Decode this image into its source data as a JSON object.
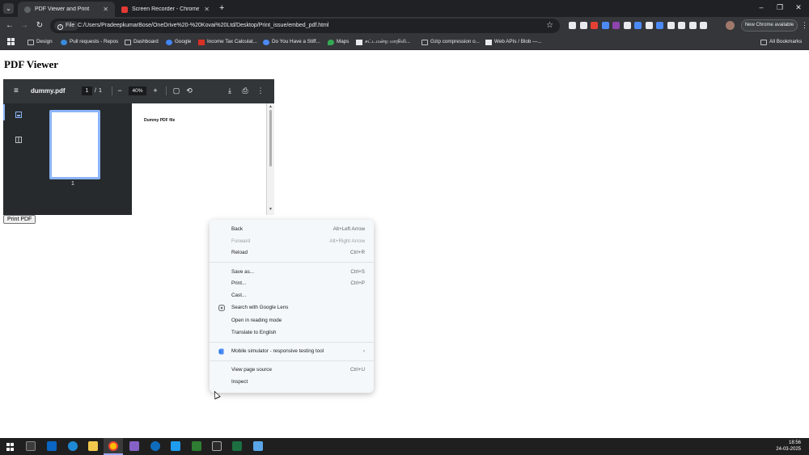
{
  "browser": {
    "tabs": [
      {
        "title": "PDF Viewer and Print",
        "close": "✕"
      },
      {
        "title": "Screen Recorder - Chrome Web",
        "close": "✕"
      }
    ],
    "tab_search_icon": "⌄",
    "new_tab": "+",
    "window_controls": {
      "minimize": "–",
      "restore": "❐",
      "close": "✕"
    },
    "nav": {
      "back": "←",
      "forward": "→",
      "reload": "↻"
    },
    "omnibox": {
      "chip": "File",
      "url": "C:/Users/PradeepkumarBose/OneDrive%20-%20Kovai%20Ltd/Desktop/Print_issue/embed_pdf.html",
      "bookmark_star": "☆"
    },
    "new_chrome_label": "New Chrome available",
    "menu_icon": "⋮",
    "extension_colors": [
      "#e8eaed",
      "#e8eaed",
      "#e44134",
      "#4c8bf5",
      "#8e44ad",
      "#e8eaed",
      "#4c8bf5",
      "#e8eaed",
      "#4c8bf5",
      "#e8eaed",
      "#e8eaed",
      "#e8eaed",
      "#e8eaed"
    ]
  },
  "bookmarks": {
    "items": [
      {
        "label": "Design",
        "icon": "folder-icon"
      },
      {
        "label": "Pull requests - Repos",
        "icon": "azure-devops-icon"
      },
      {
        "label": "Dashboard",
        "icon": "folder-icon"
      },
      {
        "label": "Google",
        "icon": "google-icon"
      },
      {
        "label": "Income Tax Calculat...",
        "icon": "calculator-icon"
      },
      {
        "label": "Do You Have a Stiff...",
        "icon": "site-icon"
      },
      {
        "label": "Maps",
        "icon": "maps-icon"
      },
      {
        "label": "சட்டமன்ற மாநிலி...",
        "icon": "site-icon"
      },
      {
        "label": "Gzip compression o...",
        "icon": "folder-icon"
      },
      {
        "label": "Web APIs / Blob —...",
        "icon": "mdn-icon"
      }
    ],
    "all_bookmarks": "All Bookmarks"
  },
  "page": {
    "title": "PDF Viewer",
    "print_button": "Print PDF"
  },
  "pdf_viewer": {
    "menu_icon": "≡",
    "filename": "dummy.pdf",
    "current_page": "1",
    "page_separator": "/",
    "total_pages": "1",
    "zoom_out": "−",
    "zoom": "40%",
    "zoom_in": "+",
    "fit_icon": "▢",
    "rotate_icon": "⟲",
    "download_icon": "⤓",
    "print_icon": "⎙",
    "more_icon": "⋮",
    "thumbnail_label": "1",
    "page_text": "Dummy PDF file"
  },
  "context_menu": {
    "items": [
      {
        "label": "Back",
        "shortcut": "Alt+Left Arrow",
        "enabled": true
      },
      {
        "label": "Forward",
        "shortcut": "Alt+Right Arrow",
        "enabled": false
      },
      {
        "label": "Reload",
        "shortcut": "Ctrl+R",
        "enabled": true
      },
      {
        "label": "Save as...",
        "shortcut": "Ctrl+S",
        "enabled": true
      },
      {
        "label": "Print...",
        "shortcut": "Ctrl+P",
        "enabled": true
      },
      {
        "label": "Cast...",
        "shortcut": "",
        "enabled": true
      },
      {
        "label": "Search with Google Lens",
        "shortcut": "",
        "enabled": true
      },
      {
        "label": "Open in reading mode",
        "shortcut": "",
        "enabled": true
      },
      {
        "label": "Translate to English",
        "shortcut": "",
        "enabled": true
      },
      {
        "label": "Mobile simulator - responsive testing tool",
        "shortcut": "›",
        "enabled": true
      },
      {
        "label": "View page source",
        "shortcut": "Ctrl+U",
        "enabled": true
      },
      {
        "label": "Inspect",
        "shortcut": "",
        "enabled": true
      }
    ]
  },
  "taskbar": {
    "time": "18:56",
    "date": "24-03-2025"
  }
}
